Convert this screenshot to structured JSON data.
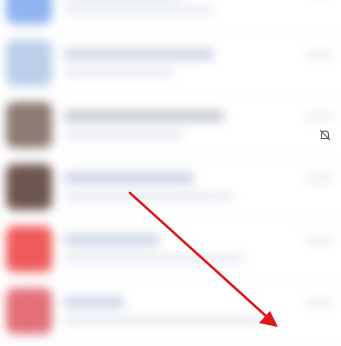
{
  "conversations": [
    {
      "avatar_color": "#8fb4ee",
      "title": "",
      "subtitle": ""
    },
    {
      "avatar_color": "#b9cfe9",
      "title": "",
      "subtitle": ""
    },
    {
      "avatar_color": "#8c7a73",
      "title": "",
      "subtitle": ""
    },
    {
      "avatar_color": "#6e5650",
      "title": "",
      "subtitle": ""
    },
    {
      "avatar_color": "#ef5a5a",
      "title": "",
      "subtitle": ""
    },
    {
      "avatar_color": "#e3707a",
      "title": "",
      "subtitle": ""
    }
  ],
  "icons": {
    "mute": "bell-off-icon",
    "annotation": "arrow-icon"
  },
  "colors": {
    "annotation_arrow": "#e01515"
  }
}
